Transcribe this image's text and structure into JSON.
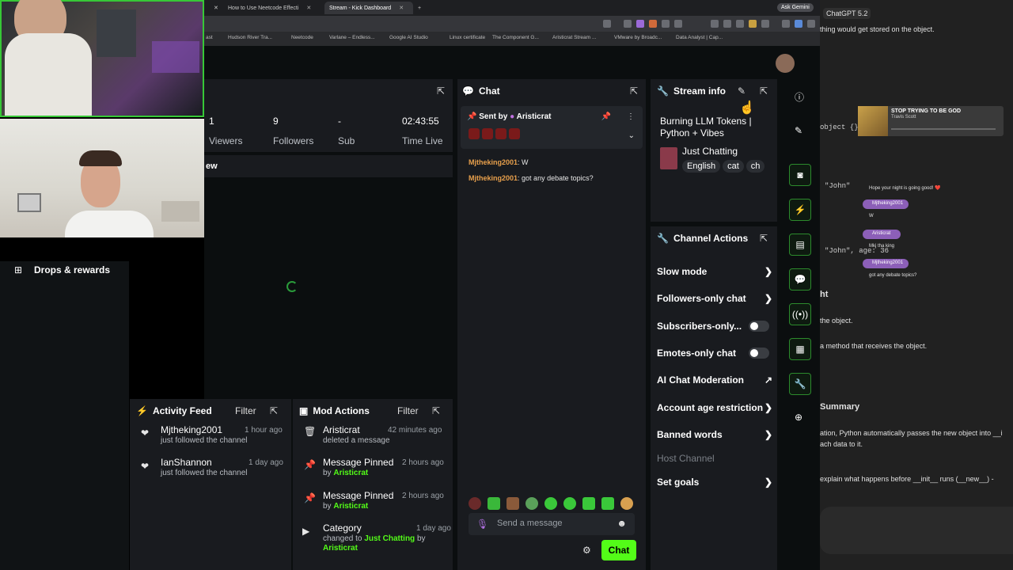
{
  "browser": {
    "tabs": [
      {
        "label": "How to Use Neetcode Effecti",
        "active": false
      },
      {
        "label": "Stream - Kick Dashboard",
        "active": true
      }
    ],
    "ask_gemini": "Ask Gemini",
    "bookmarks": [
      "ast",
      "Hudson River Tra...",
      "Neetcode",
      "Varlane – Endless...",
      "Google AI Studio",
      "Linux certificate",
      "The Component G...",
      "Aristicrat Stream ...",
      "VMware by Broadc...",
      "Data Analyst | Cap..."
    ]
  },
  "sidebar": {
    "drops_label": "Drops & rewards"
  },
  "stats": {
    "viewers": {
      "value": "1",
      "label": "Viewers"
    },
    "followers": {
      "value": "9",
      "label": "Followers"
    },
    "subs": {
      "value": "-",
      "label": "Sub"
    },
    "time": {
      "value": "02:43:55",
      "label": "Time Live"
    },
    "preview_label": "ew"
  },
  "chat": {
    "title": "Chat",
    "pinned_prefix": "Sent by",
    "pinned_user": "Aristicrat",
    "messages": [
      {
        "user": "Mjtheking2001",
        "text": "W"
      },
      {
        "user": "Mjtheking2001",
        "text": "got any debate topics?"
      }
    ],
    "input_placeholder": "Send a message",
    "send_label": "Chat"
  },
  "stream_info": {
    "title": "Stream info",
    "stream_title": "Burning LLM Tokens | Python + Vibes",
    "category": "Just Chatting",
    "tags": [
      "English",
      "cat",
      "ch"
    ]
  },
  "channel_actions": {
    "title": "Channel Actions",
    "items": [
      {
        "label": "Slow mode",
        "control": "chevron"
      },
      {
        "label": "Followers-only chat",
        "control": "chevron"
      },
      {
        "label": "Subscribers-only...",
        "control": "toggle"
      },
      {
        "label": "Emotes-only chat",
        "control": "toggle"
      },
      {
        "label": "AI Chat Moderation",
        "control": "external"
      },
      {
        "label": "Account age restriction",
        "control": "chevron"
      },
      {
        "label": "Banned words",
        "control": "chevron"
      },
      {
        "label": "Host Channel",
        "control": "none"
      },
      {
        "label": "Set goals",
        "control": "chevron"
      }
    ]
  },
  "activity_feed": {
    "title": "Activity Feed",
    "filter": "Filter",
    "items": [
      {
        "name": "Mjtheking2001",
        "time": "1 hour ago",
        "sub": "just followed the channel"
      },
      {
        "name": "IanShannon",
        "time": "1 day ago",
        "sub": "just followed the channel"
      }
    ]
  },
  "mod_actions": {
    "title": "Mod Actions",
    "filter": "Filter",
    "items": [
      {
        "name": "Aristicrat",
        "time": "42 minutes ago",
        "sub": "deleted a message",
        "by": ""
      },
      {
        "name": "Message Pinned",
        "time": "2 hours ago",
        "sub": "by",
        "by": "Aristicrat"
      },
      {
        "name": "Message Pinned",
        "time": "2 hours ago",
        "sub": "by",
        "by": "Aristicrat"
      },
      {
        "name": "Category",
        "time": "1 day ago",
        "sub": "changed to",
        "category": "Just Chatting",
        "by_word": "by",
        "by": "Aristicrat"
      }
    ]
  },
  "chatgpt": {
    "title": "ChatGPT 5.2",
    "line1": "thing would get stored on the object.",
    "code1": "object {}",
    "song_title": "STOP TRYING TO BE GOD",
    "song_artist": "Travis Scott",
    "overlay_msgs": [
      "Hope your night is going good! ❤️",
      "Mjtheking2001",
      "W",
      "Aristicrat",
      "Mkj tha king",
      "Mjtheking2001",
      "got any debate topics?"
    ],
    "code2": "\"John\"",
    "code3": "\"John\", age: 36",
    "h1": "ht",
    "t1": "the object.",
    "t2": "a method that receives the object.",
    "summary": "Summary",
    "t3": "ation, Python automatically passes the new object into __i",
    "t4": "ach data to it.",
    "t5": "explain what happens before __init__ runs (__new__) -"
  }
}
